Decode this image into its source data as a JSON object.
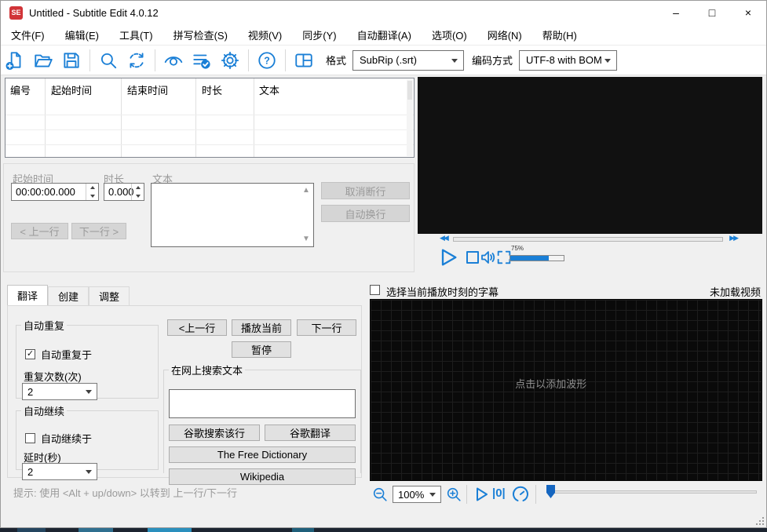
{
  "window": {
    "title": "Untitled - Subtitle Edit 4.0.12",
    "icon_text": "SE",
    "controls": {
      "minimize": "–",
      "maximize": "□",
      "close": "×"
    }
  },
  "menu": {
    "items": [
      "文件(F)",
      "编辑(E)",
      "工具(T)",
      "拼写检查(S)",
      "视频(V)",
      "同步(Y)",
      "自动翻译(A)",
      "选项(O)",
      "网络(N)",
      "帮助(H)"
    ]
  },
  "toolbar": {
    "icons": [
      "new-file",
      "open-folder",
      "save",
      "find",
      "replace",
      "visual-sync",
      "spell-check",
      "settings",
      "help",
      "layout"
    ],
    "format_label": "格式",
    "format_value": "SubRip (.srt)",
    "encoding_label": "编码方式",
    "encoding_value": "UTF-8 with BOM"
  },
  "subtitle_list": {
    "columns": [
      "编号",
      "起始时间",
      "结束时间",
      "时长",
      "文本"
    ],
    "rows": []
  },
  "editor": {
    "start_time_label": "起始时间",
    "duration_label": "时长",
    "text_label": "文本",
    "start_time_value": "00:00:00.000",
    "duration_value": "0.000",
    "text_value": "",
    "unbreak_button": "取消断行",
    "auto_wrap_button": "自动换行",
    "prev_line_button": "< 上一行",
    "next_line_button": "下一行 >"
  },
  "player": {
    "volume_percent": "75%",
    "icons": [
      "rewind",
      "seek-bar",
      "forward",
      "play",
      "stop",
      "volume",
      "fullscreen"
    ]
  },
  "bottom_tabs": {
    "tabs": [
      "翻译",
      "创建",
      "调整"
    ],
    "active": "翻译"
  },
  "translate": {
    "auto_repeat": {
      "legend": "自动重复",
      "checkbox_label": "自动重复于",
      "checked": true,
      "check_glyph": "✓",
      "count_label": "重复次数(次)",
      "count_value": "2"
    },
    "auto_continue": {
      "legend": "自动继续",
      "checkbox_label": "自动继续于",
      "checked": false,
      "check_glyph": "",
      "delay_label": "延时(秒)",
      "delay_value": "2"
    },
    "controls": {
      "prev": "<上一行",
      "play_current": "播放当前",
      "next": "下一行",
      "pause": "暂停"
    },
    "web_search": {
      "legend": "在网上搜索文本",
      "query_value": "",
      "google_search_line": "谷歌搜索该行",
      "google_translate": "谷歌翻译",
      "free_dictionary": "The Free Dictionary",
      "wikipedia": "Wikipedia"
    },
    "hint": "提示: 使用 <Alt + up/down> 以转到 上一行/下一行"
  },
  "waveform": {
    "select_current_label": "选择当前播放时刻的字幕",
    "no_video_label": "未加载视频",
    "placeholder": "点击以添加波形",
    "zoom_value": "100%",
    "play_from_start_glyph": "|0|"
  },
  "colors": {
    "accent_blue": "#1a7fd6",
    "logo_red": "#d13438",
    "disabled_text": "#9a9a9a"
  }
}
